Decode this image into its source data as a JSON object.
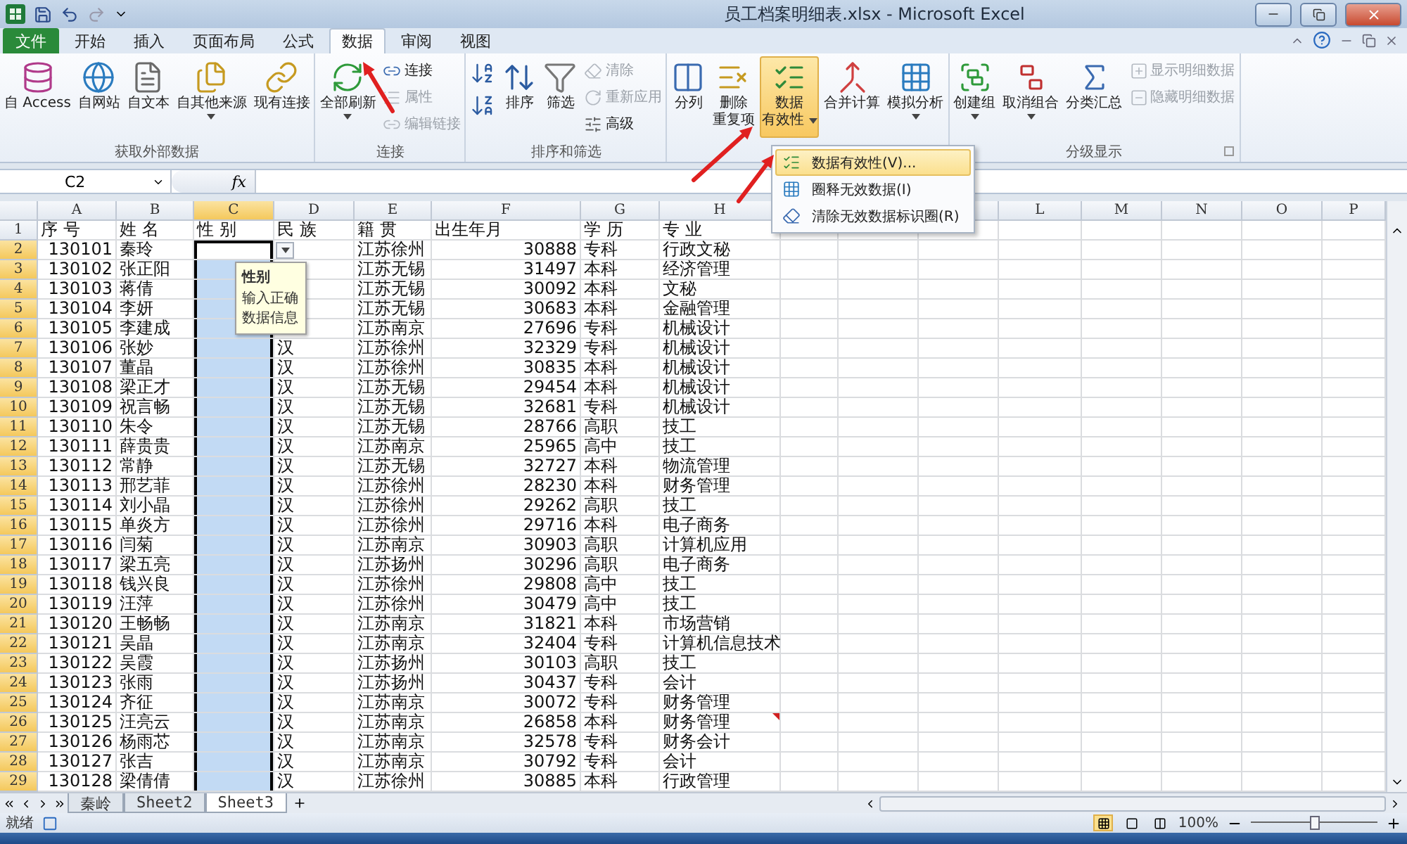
{
  "window": {
    "title": "员工档案明细表.xlsx - Microsoft Excel"
  },
  "tabs": [
    {
      "label": "文件",
      "kind": "file",
      "selected": false
    },
    {
      "label": "开始",
      "kind": "tab",
      "selected": false
    },
    {
      "label": "插入",
      "kind": "tab",
      "selected": false
    },
    {
      "label": "页面布局",
      "kind": "tab",
      "selected": false
    },
    {
      "label": "公式",
      "kind": "tab",
      "selected": false
    },
    {
      "label": "数据",
      "kind": "tab",
      "selected": true
    },
    {
      "label": "审阅",
      "kind": "tab",
      "selected": false
    },
    {
      "label": "视图",
      "kind": "tab",
      "selected": false
    }
  ],
  "ribbon": [
    {
      "label": "获取外部数据",
      "items": [
        {
          "kind": "large",
          "lines": [
            "自 Access"
          ]
        },
        {
          "kind": "large",
          "lines": [
            "自网站"
          ]
        },
        {
          "kind": "large",
          "lines": [
            "自文本"
          ]
        },
        {
          "kind": "large",
          "lines": [
            "自其他来源"
          ],
          "caret": true
        },
        {
          "kind": "large",
          "lines": [
            "现有连接"
          ]
        }
      ]
    },
    {
      "label": "连接",
      "items": [
        {
          "kind": "large",
          "lines": [
            "全部刷新"
          ],
          "caret": true
        },
        {
          "kind": "stack",
          "items": [
            {
              "label": "连接",
              "disabled": false
            },
            {
              "label": "属性",
              "disabled": true
            },
            {
              "label": "编辑链接",
              "disabled": true
            }
          ]
        }
      ]
    },
    {
      "label": "排序和筛选",
      "items": [
        {
          "kind": "stack",
          "items": [
            {
              "disabled": false
            },
            {
              "disabled": false
            }
          ]
        },
        {
          "kind": "large",
          "lines": [
            "排序"
          ]
        },
        {
          "kind": "large",
          "lines": [
            "筛选"
          ]
        },
        {
          "kind": "stack",
          "items": [
            {
              "label": "清除",
              "disabled": true
            },
            {
              "label": "重新应用",
              "disabled": true
            },
            {
              "label": "高级",
              "disabled": false
            }
          ]
        }
      ]
    },
    {
      "items": [
        {
          "kind": "large",
          "lines": [
            "分列"
          ]
        },
        {
          "kind": "large",
          "lines": [
            "删除",
            "重复项"
          ]
        },
        {
          "kind": "large",
          "lines": [
            "数据",
            "有效性"
          ],
          "caret": true,
          "selected": true
        },
        {
          "kind": "large",
          "lines": [
            "合并计算"
          ]
        },
        {
          "kind": "large",
          "lines": [
            "模拟分析"
          ],
          "caret": true
        }
      ]
    },
    {
      "label": "分级显示",
      "launcher": true,
      "items": [
        {
          "kind": "large",
          "lines": [
            "创建组"
          ],
          "caret": true
        },
        {
          "kind": "large",
          "lines": [
            "取消组合"
          ],
          "caret": true
        },
        {
          "kind": "large",
          "lines": [
            "分类汇总"
          ]
        },
        {
          "kind": "stack",
          "items": [
            {
              "label": "显示明细数据",
              "disabled": true
            },
            {
              "label": "隐藏明细数据",
              "disabled": true
            }
          ]
        }
      ]
    }
  ],
  "menu": [
    {
      "label": "数据有效性(V)...",
      "selected": true
    },
    {
      "label": "圈释无效数据(I)",
      "selected": false
    },
    {
      "label": "清除无效数据标识圈(R)",
      "selected": false
    }
  ],
  "formula_bar": {
    "name_box": "C2",
    "function_label": "fx"
  },
  "columns": [
    {
      "letter": "A",
      "selected": false
    },
    {
      "letter": "B",
      "selected": false
    },
    {
      "letter": "C",
      "selected": true
    },
    {
      "letter": "D",
      "selected": false
    },
    {
      "letter": "E",
      "selected": false
    },
    {
      "letter": "F",
      "selected": false
    },
    {
      "letter": "G",
      "selected": false
    },
    {
      "letter": "H",
      "selected": false
    },
    null,
    null,
    {
      "selected": false
    },
    {
      "letter": "L",
      "selected": false
    },
    {
      "letter": "M",
      "selected": false
    },
    {
      "letter": "N",
      "selected": false
    },
    {
      "letter": "O",
      "selected": false
    },
    {
      "letter": "P",
      "selected": false
    }
  ],
  "rows": [
    {
      "row": "1",
      "selected": false,
      "A": "序 号",
      "B": "姓 名",
      "C": "性 别",
      "D": "民 族",
      "E": "籍 贯",
      "F": "出生年月",
      "G": "学 历",
      "H": "专 业"
    },
    {
      "row": "2",
      "selected": true,
      "A": "130101",
      "B": "秦玲",
      "E": "江苏徐州",
      "F": "30888",
      "G": "专科",
      "H": "行政文秘"
    },
    {
      "row": "3",
      "selected": true,
      "A": "130102",
      "B": "张正阳",
      "E": "江苏无锡",
      "F": "31497",
      "G": "本科",
      "H": "经济管理"
    },
    {
      "row": "4",
      "selected": true,
      "A": "130103",
      "B": "蒋倩",
      "E": "江苏无锡",
      "F": "30092",
      "G": "本科",
      "H": "文秘"
    },
    {
      "row": "5",
      "selected": true,
      "A": "130104",
      "B": "李妍",
      "E": "江苏无锡",
      "F": "30683",
      "G": "本科",
      "H": "金融管理"
    },
    {
      "row": "6",
      "selected": true,
      "A": "130105",
      "B": "李建成",
      "E": "江苏南京",
      "F": "27696",
      "G": "专科",
      "H": "机械设计"
    },
    {
      "row": "7",
      "selected": true,
      "A": "130106",
      "B": "张妙",
      "D": "汉",
      "E": "江苏徐州",
      "F": "32329",
      "G": "专科",
      "H": "机械设计"
    },
    {
      "row": "8",
      "selected": true,
      "A": "130107",
      "B": "董晶",
      "D": "汉",
      "E": "江苏徐州",
      "F": "30835",
      "G": "本科",
      "H": "机械设计"
    },
    {
      "row": "9",
      "selected": true,
      "A": "130108",
      "B": "梁正才",
      "D": "汉",
      "E": "江苏无锡",
      "F": "29454",
      "G": "本科",
      "H": "机械设计"
    },
    {
      "row": "10",
      "selected": true,
      "A": "130109",
      "B": "祝言畅",
      "D": "汉",
      "E": "江苏无锡",
      "F": "32681",
      "G": "专科",
      "H": "机械设计"
    },
    {
      "row": "11",
      "selected": true,
      "A": "130110",
      "B": "朱令",
      "D": "汉",
      "E": "江苏无锡",
      "F": "28766",
      "G": "高职",
      "H": "技工"
    },
    {
      "row": "12",
      "selected": true,
      "A": "130111",
      "B": "薛贵贵",
      "D": "汉",
      "E": "江苏南京",
      "F": "25965",
      "G": "高中",
      "H": "技工"
    },
    {
      "row": "13",
      "selected": true,
      "A": "130112",
      "B": "常静",
      "D": "汉",
      "E": "江苏无锡",
      "F": "32727",
      "G": "本科",
      "H": "物流管理"
    },
    {
      "row": "14",
      "selected": true,
      "A": "130113",
      "B": "邢艺菲",
      "D": "汉",
      "E": "江苏徐州",
      "F": "28230",
      "G": "本科",
      "H": "财务管理"
    },
    {
      "row": "15",
      "selected": true,
      "A": "130114",
      "B": "刘小晶",
      "D": "汉",
      "E": "江苏徐州",
      "F": "29262",
      "G": "高职",
      "H": "技工"
    },
    {
      "row": "16",
      "selected": true,
      "A": "130115",
      "B": "单炎方",
      "D": "汉",
      "E": "江苏徐州",
      "F": "29716",
      "G": "本科",
      "H": "电子商务"
    },
    {
      "row": "17",
      "selected": true,
      "A": "130116",
      "B": "闫菊",
      "D": "汉",
      "E": "江苏南京",
      "F": "30903",
      "G": "高职",
      "H": "计算机应用"
    },
    {
      "row": "18",
      "selected": true,
      "A": "130117",
      "B": "梁五亮",
      "D": "汉",
      "E": "江苏扬州",
      "F": "30296",
      "G": "高职",
      "H": "电子商务"
    },
    {
      "row": "19",
      "selected": true,
      "A": "130118",
      "B": "钱兴良",
      "D": "汉",
      "E": "江苏徐州",
      "F": "29808",
      "G": "高中",
      "H": "技工"
    },
    {
      "row": "20",
      "selected": true,
      "A": "130119",
      "B": "汪萍",
      "D": "汉",
      "E": "江苏徐州",
      "F": "30479",
      "G": "高中",
      "H": "技工"
    },
    {
      "row": "21",
      "selected": true,
      "A": "130120",
      "B": "王畅畅",
      "D": "汉",
      "E": "江苏南京",
      "F": "31821",
      "G": "本科",
      "H": "市场营销"
    },
    {
      "row": "22",
      "selected": true,
      "A": "130121",
      "B": "吴晶",
      "D": "汉",
      "E": "江苏南京",
      "F": "32404",
      "G": "专科",
      "H": "计算机信息技术"
    },
    {
      "row": "23",
      "selected": true,
      "A": "130122",
      "B": "吴霞",
      "D": "汉",
      "E": "江苏扬州",
      "F": "30103",
      "G": "高职",
      "H": "技工"
    },
    {
      "row": "24",
      "selected": true,
      "A": "130123",
      "B": "张雨",
      "D": "汉",
      "E": "江苏扬州",
      "F": "30437",
      "G": "专科",
      "H": "会计"
    },
    {
      "row": "25",
      "selected": true,
      "A": "130124",
      "B": "齐征",
      "D": "汉",
      "E": "江苏南京",
      "F": "30072",
      "G": "专科",
      "H": "财务管理"
    },
    {
      "row": "26",
      "selected": true,
      "A": "130125",
      "B": "汪亮云",
      "D": "汉",
      "E": "江苏南京",
      "F": "26858",
      "G": "本科",
      "H": "财务管理",
      "comment": true
    },
    {
      "row": "27",
      "selected": true,
      "A": "130126",
      "B": "杨雨芯",
      "D": "汉",
      "E": "江苏南京",
      "F": "32578",
      "G": "专科",
      "H": "财务会计"
    },
    {
      "row": "28",
      "selected": true,
      "A": "130127",
      "B": "张吉",
      "D": "汉",
      "E": "江苏南京",
      "F": "30792",
      "G": "专科",
      "H": "会计"
    },
    {
      "row": "29",
      "selected": true,
      "A": "130128",
      "B": "梁倩倩",
      "D": "汉",
      "E": "江苏徐州",
      "F": "30885",
      "G": "本科",
      "H": "行政管理"
    }
  ],
  "validation_dropdown": true,
  "input_tip": {
    "title": "性别",
    "message": "输入正确数据信息"
  },
  "sheet_tabs": [
    {
      "label": "秦岭",
      "selected": false
    },
    {
      "label": "Sheet2",
      "selected": false
    },
    {
      "label": "Sheet3",
      "selected": true
    }
  ],
  "status_bar": {
    "status": "就绪",
    "zoom": "100%",
    "zoom_slider": {
      "level": 0.5
    }
  }
}
